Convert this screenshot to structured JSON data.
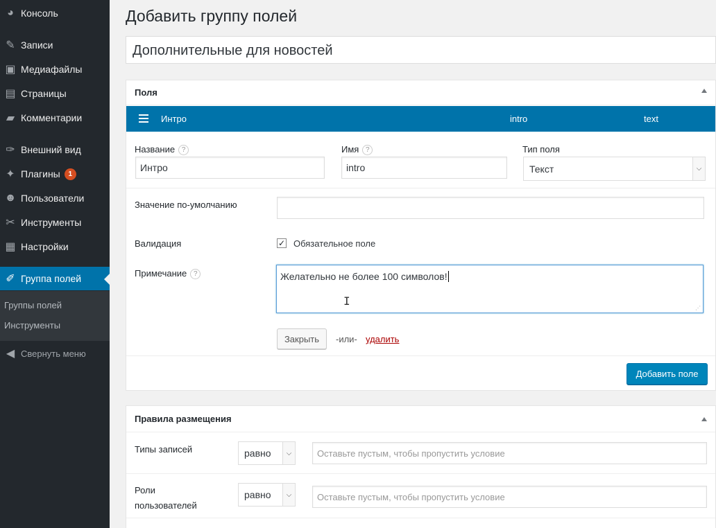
{
  "sidebar": {
    "items": [
      {
        "label": "Консоль",
        "icon": "dashboard-icon",
        "glyph": "◕"
      },
      {
        "label": "Записи",
        "icon": "pin-icon",
        "glyph": "✎"
      },
      {
        "label": "Медиафайлы",
        "icon": "media-icon",
        "glyph": "▣"
      },
      {
        "label": "Страницы",
        "icon": "pages-icon",
        "glyph": "▤"
      },
      {
        "label": "Комментарии",
        "icon": "comment-icon",
        "glyph": "▰"
      },
      {
        "label": "Внешний вид",
        "icon": "brush-icon",
        "glyph": "✑"
      },
      {
        "label": "Плагины",
        "icon": "plugin-icon",
        "glyph": "✦",
        "badge": "1"
      },
      {
        "label": "Пользователи",
        "icon": "users-icon",
        "glyph": "☻"
      },
      {
        "label": "Инструменты",
        "icon": "wrench-icon",
        "glyph": "✂"
      },
      {
        "label": "Настройки",
        "icon": "settings-icon",
        "glyph": "▦"
      },
      {
        "label": "Группа полей",
        "icon": "carrot-icon",
        "glyph": "✐"
      }
    ],
    "submenu": [
      "Группы полей",
      "Инструменты"
    ],
    "collapse_label": "Свернуть меню"
  },
  "page": {
    "title": "Добавить группу полей",
    "group_title_value": "Дополнительные для новостей"
  },
  "fields_box": {
    "heading": "Поля",
    "field": {
      "label": "Интро",
      "name": "intro",
      "type": "text"
    },
    "form": {
      "label_caption": "Название",
      "label_value": "Интро",
      "name_caption": "Имя",
      "name_value": "intro",
      "type_caption": "Тип поля",
      "type_value": "Текст",
      "default_caption": "Значение по-умолчанию",
      "default_value": "",
      "validation_caption": "Валидация",
      "required_label": "Обязательное поле",
      "required_checked": true,
      "note_caption": "Примечание",
      "note_value": "Желательно не более 100 символов!"
    },
    "close_button": "Закрыть",
    "or_text": "-или-",
    "delete_link": "удалить",
    "add_field_button": "Добавить поле",
    "help_mark": "?"
  },
  "location_box": {
    "heading": "Правила размещения",
    "rules": [
      {
        "label": "Типы записей",
        "operator": "равно",
        "placeholder": "Оставьте пустым, чтобы пропустить условие"
      },
      {
        "label": "Роли пользователей",
        "label_line1": "Роли",
        "label_line2": "пользователей",
        "operator": "равно",
        "placeholder": "Оставьте пустым, чтобы пропустить условие"
      }
    ]
  },
  "colors": {
    "sidebar_bg": "#23282d",
    "accent": "#0073aa",
    "primary_button": "#0085ba",
    "delete_link": "#a00000",
    "badge": "#d54e21"
  }
}
